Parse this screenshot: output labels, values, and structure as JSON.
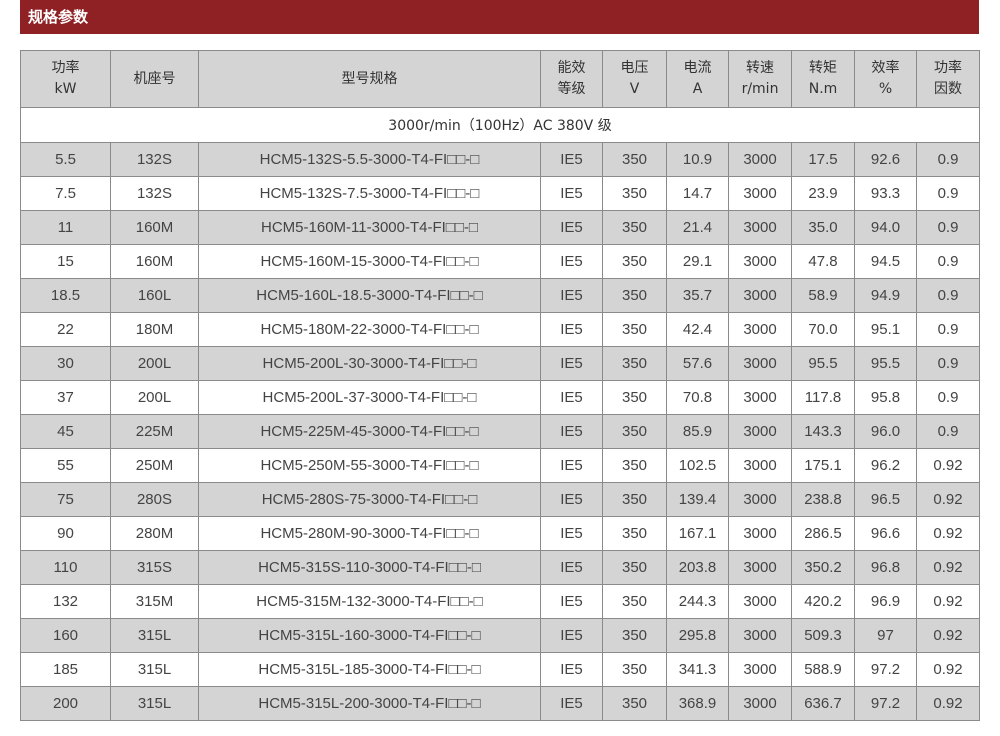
{
  "section": {
    "title": "规格参数"
  },
  "table": {
    "headers": [
      [
        "功率",
        "kW"
      ],
      [
        "机座号"
      ],
      [
        "型号规格"
      ],
      [
        "能效",
        "等级"
      ],
      [
        "电压",
        "V"
      ],
      [
        "电流",
        "A"
      ],
      [
        "转速",
        "r/min"
      ],
      [
        "转矩",
        "N.m"
      ],
      [
        "效率",
        "%"
      ],
      [
        "功率",
        "因数"
      ]
    ],
    "group_label": "3000r/min（100Hz）AC 380V 级",
    "rows": [
      [
        "5.5",
        "132S",
        "HCM5-132S-5.5-3000-T4-FI□□-□",
        "IE5",
        "350",
        "10.9",
        "3000",
        "17.5",
        "92.6",
        "0.9"
      ],
      [
        "7.5",
        "132S",
        "HCM5-132S-7.5-3000-T4-FI□□-□",
        "IE5",
        "350",
        "14.7",
        "3000",
        "23.9",
        "93.3",
        "0.9"
      ],
      [
        "11",
        "160M",
        "HCM5-160M-11-3000-T4-FI□□-□",
        "IE5",
        "350",
        "21.4",
        "3000",
        "35.0",
        "94.0",
        "0.9"
      ],
      [
        "15",
        "160M",
        "HCM5-160M-15-3000-T4-FI□□-□",
        "IE5",
        "350",
        "29.1",
        "3000",
        "47.8",
        "94.5",
        "0.9"
      ],
      [
        "18.5",
        "160L",
        "HCM5-160L-18.5-3000-T4-FI□□-□",
        "IE5",
        "350",
        "35.7",
        "3000",
        "58.9",
        "94.9",
        "0.9"
      ],
      [
        "22",
        "180M",
        "HCM5-180M-22-3000-T4-FI□□-□",
        "IE5",
        "350",
        "42.4",
        "3000",
        "70.0",
        "95.1",
        "0.9"
      ],
      [
        "30",
        "200L",
        "HCM5-200L-30-3000-T4-FI□□-□",
        "IE5",
        "350",
        "57.6",
        "3000",
        "95.5",
        "95.5",
        "0.9"
      ],
      [
        "37",
        "200L",
        "HCM5-200L-37-3000-T4-FI□□-□",
        "IE5",
        "350",
        "70.8",
        "3000",
        "117.8",
        "95.8",
        "0.9"
      ],
      [
        "45",
        "225M",
        "HCM5-225M-45-3000-T4-FI□□-□",
        "IE5",
        "350",
        "85.9",
        "3000",
        "143.3",
        "96.0",
        "0.9"
      ],
      [
        "55",
        "250M",
        "HCM5-250M-55-3000-T4-FI□□-□",
        "IE5",
        "350",
        "102.5",
        "3000",
        "175.1",
        "96.2",
        "0.92"
      ],
      [
        "75",
        "280S",
        "HCM5-280S-75-3000-T4-FI□□-□",
        "IE5",
        "350",
        "139.4",
        "3000",
        "238.8",
        "96.5",
        "0.92"
      ],
      [
        "90",
        "280M",
        "HCM5-280M-90-3000-T4-FI□□-□",
        "IE5",
        "350",
        "167.1",
        "3000",
        "286.5",
        "96.6",
        "0.92"
      ],
      [
        "110",
        "315S",
        "HCM5-315S-110-3000-T4-FI□□-□",
        "IE5",
        "350",
        "203.8",
        "3000",
        "350.2",
        "96.8",
        "0.92"
      ],
      [
        "132",
        "315M",
        "HCM5-315M-132-3000-T4-FI□□-□",
        "IE5",
        "350",
        "244.3",
        "3000",
        "420.2",
        "96.9",
        "0.92"
      ],
      [
        "160",
        "315L",
        "HCM5-315L-160-3000-T4-FI□□-□",
        "IE5",
        "350",
        "295.8",
        "3000",
        "509.3",
        "97",
        "0.92"
      ],
      [
        "185",
        "315L",
        "HCM5-315L-185-3000-T4-FI□□-□",
        "IE5",
        "350",
        "341.3",
        "3000",
        "588.9",
        "97.2",
        "0.92"
      ],
      [
        "200",
        "315L",
        "HCM5-315L-200-3000-T4-FI□□-□",
        "IE5",
        "350",
        "368.9",
        "3000",
        "636.7",
        "97.2",
        "0.92"
      ]
    ]
  }
}
